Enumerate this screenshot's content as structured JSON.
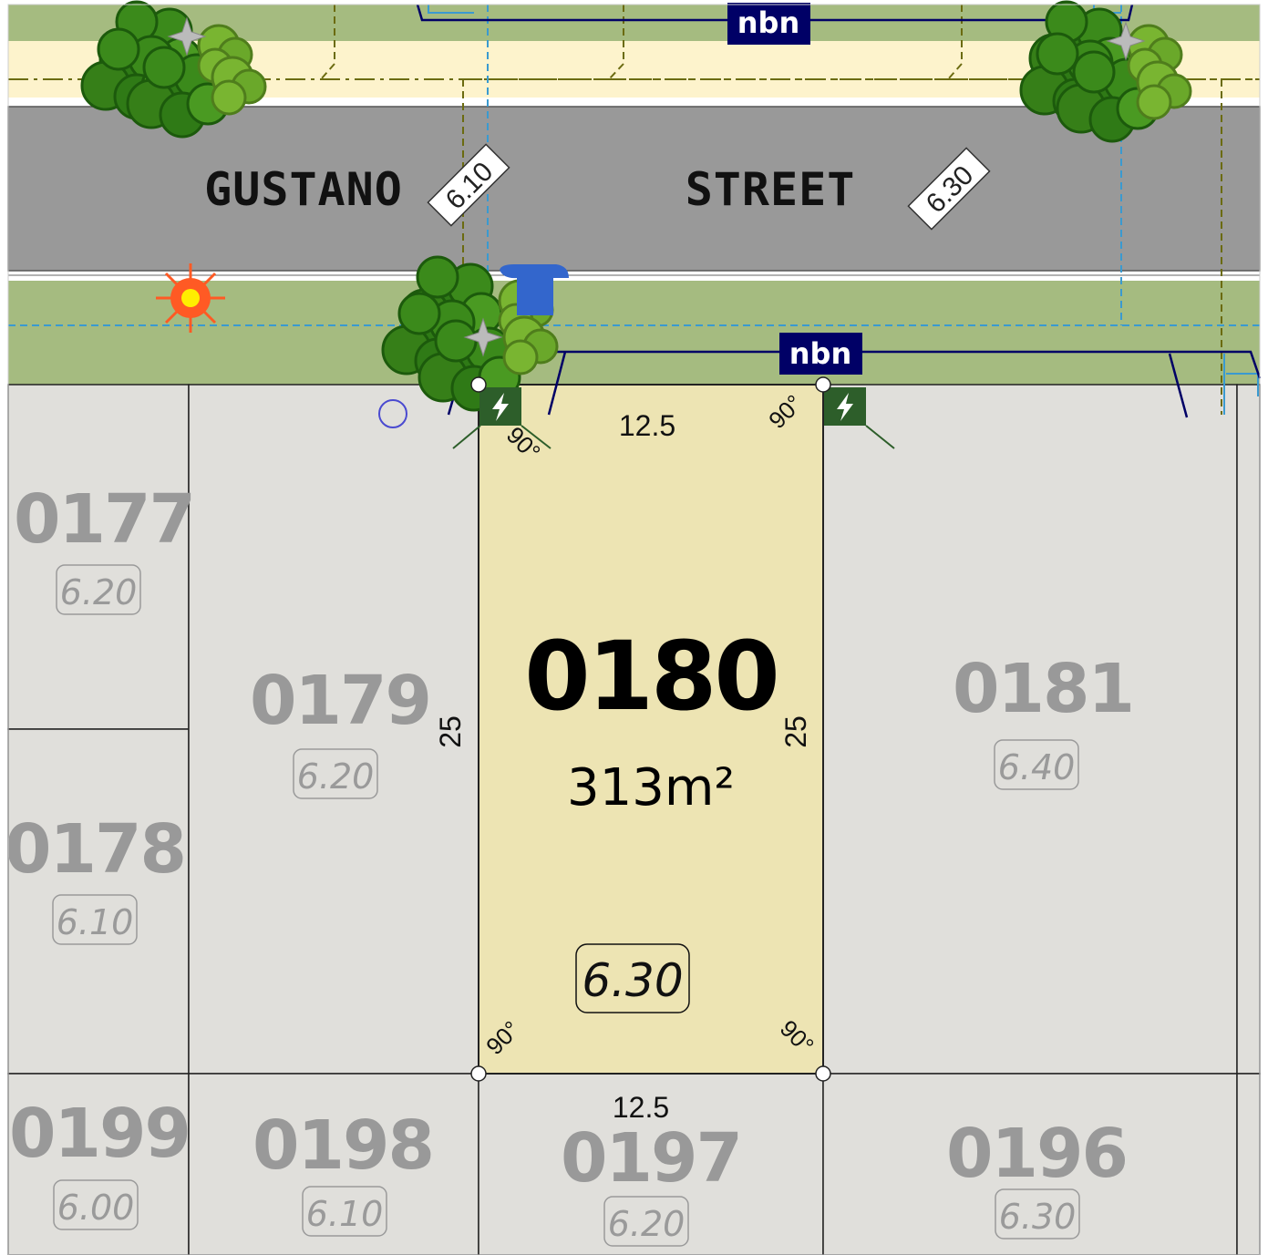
{
  "street": {
    "name_left": "GUSTANO",
    "name_right": "STREET"
  },
  "road_levels": [
    "6.10",
    "6.30"
  ],
  "nbn_labels": [
    "nbn",
    "nbn"
  ],
  "featured_lot": {
    "number": "0180",
    "area": "313m²",
    "level": "6.30",
    "frontage": "12.5",
    "rear": "12.5",
    "depth_left": "25",
    "depth_right": "25",
    "angles": [
      "90°",
      "90°",
      "90°",
      "90°"
    ]
  },
  "lots": [
    {
      "number": "0177",
      "level": "6.20"
    },
    {
      "number": "0178",
      "level": "6.10"
    },
    {
      "number": "0179",
      "level": "6.20"
    },
    {
      "number": "0181",
      "level": "6.40"
    },
    {
      "number": "0199",
      "level": "6.00"
    },
    {
      "number": "0198",
      "level": "6.10"
    },
    {
      "number": "0197",
      "level": "6.20"
    },
    {
      "number": "0196",
      "level": "6.30"
    }
  ],
  "icons": [
    "tree-icon",
    "power-pit-icon",
    "street-light-icon",
    "water-meter-icon",
    "survey-marker-icon",
    "nbn-pit-icon"
  ],
  "colors": {
    "road": "#999999",
    "verge": "#a5bb80",
    "footpath": "#fdf3cc",
    "featured_lot": "#ede4b3",
    "other_lot": "#e0dfdb",
    "nbn": "#000066",
    "power_pit": "#2d5e2a",
    "water_meter": "#3366cc",
    "street_light": "#ff5a24"
  }
}
